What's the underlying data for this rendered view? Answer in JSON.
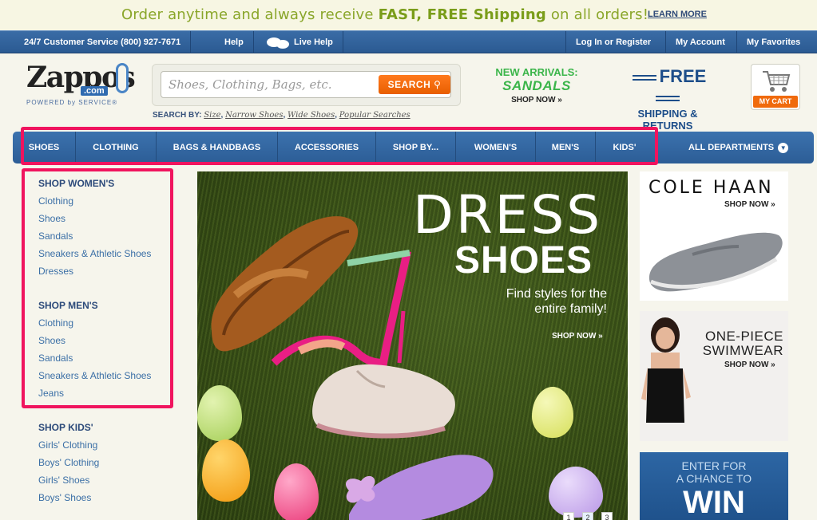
{
  "promo": {
    "text_pre": "Order anytime and always receive ",
    "text_bold": "FAST, FREE Shipping",
    "text_post": " on all orders!",
    "learn_more": "LEARN MORE"
  },
  "utility": {
    "customer_service": "24/7 Customer Service (800) 927-7671",
    "help": "Help",
    "live_help": "Live Help",
    "login": "Log In or Register",
    "account": "My Account",
    "favorites": "My Favorites"
  },
  "logo": {
    "word": "Zappos",
    "com": ".com",
    "tagline": "POWERED by SERVICE®"
  },
  "search": {
    "placeholder": "Shoes, Clothing, Bags, etc.",
    "button": "SEARCH",
    "by_label": "SEARCH BY:",
    "links": [
      "Size",
      "Narrow Shoes",
      "Wide Shoes",
      "Popular Searches"
    ]
  },
  "new_arrivals": {
    "line1": "NEW ARRIVALS:",
    "line2": "SANDALS",
    "cta": "SHOP NOW »"
  },
  "free_ship": {
    "line1": "FREE",
    "line2": "SHIPPING & RETURNS"
  },
  "cart": {
    "label": "MY CART"
  },
  "nav": {
    "items": [
      "SHOES",
      "CLOTHING",
      "BAGS & HANDBAGS",
      "ACCESSORIES",
      "SHOP BY...",
      "WOMEN'S",
      "MEN'S",
      "KIDS'"
    ],
    "all": "ALL DEPARTMENTS"
  },
  "sidebar": {
    "women_head": "SHOP WOMEN'S",
    "women": [
      "Clothing",
      "Shoes",
      "Sandals",
      "Sneakers & Athletic Shoes",
      "Dresses"
    ],
    "men_head": "SHOP MEN'S",
    "men": [
      "Clothing",
      "Shoes",
      "Sandals",
      "Sneakers & Athletic Shoes",
      "Jeans"
    ],
    "kids_head": "SHOP KIDS'",
    "kids": [
      "Girls' Clothing",
      "Boys' Clothing",
      "Girls' Shoes",
      "Boys' Shoes"
    ]
  },
  "hero": {
    "line1": "DRESS",
    "line2": "SHOES",
    "sub": "Find styles for the entire family!",
    "cta": "SHOP NOW »",
    "pages": [
      "1",
      "2",
      "3"
    ]
  },
  "ads": {
    "cole_haan": {
      "brand": "COLE HAAN",
      "cta": "SHOP NOW »"
    },
    "swim": {
      "title": "ONE-PIECE SWIMWEAR",
      "cta": "SHOP NOW »"
    },
    "win": {
      "line1": "ENTER FOR",
      "line2": "A CHANCE TO",
      "line3": "WIN"
    }
  },
  "colors": {
    "highlight": "#f0145e",
    "nav_blue": "#2c5d96",
    "accent_orange": "#f06a0c",
    "green": "#3bb54a"
  }
}
